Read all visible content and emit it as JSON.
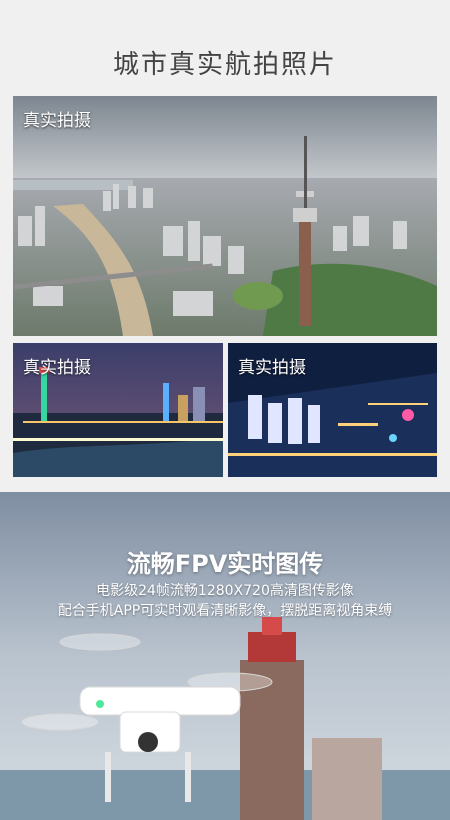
{
  "header": {
    "title": "城市真实航拍照片"
  },
  "photos": [
    {
      "label": "真实拍摄"
    },
    {
      "label": "真实拍摄"
    },
    {
      "label": "真实拍摄"
    }
  ],
  "fpv": {
    "title": "流畅FPV实时图传",
    "line1": "电影级24帧流畅1280X720高清图传影像",
    "line2": "配合手机APP可实时观看清晰影像，摆脱距离视角束缚"
  }
}
